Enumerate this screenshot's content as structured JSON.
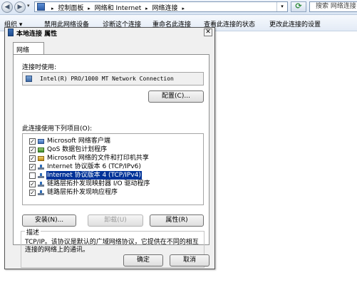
{
  "explorer": {
    "address": {
      "crumbs": [
        "控制面板",
        "网络和 Internet",
        "网络连接"
      ]
    },
    "search_placeholder": "搜索 网络连接",
    "toolbar": [
      "组织 ▾",
      "禁用此网络设备",
      "诊断这个连接",
      "重命名此连接",
      "查看此连接的状态",
      "更改此连接的设置"
    ],
    "icons": {
      "back": "back-arrow-icon",
      "forward": "forward-arrow-icon",
      "refresh": "refresh-icon"
    }
  },
  "dialog": {
    "title": "本地连接 属性",
    "close_glyph": "✕",
    "tab": "网络",
    "connect_using_label": "连接时使用:",
    "adapter_name": "Intel(R) PRO/1000 MT Network Connection",
    "configure_button": "配置(C)...",
    "items_label": "此连接使用下列项目(O):",
    "items": [
      {
        "label": "Microsoft 网络客户端",
        "checked": true,
        "icon": "client-icon",
        "selected": false
      },
      {
        "label": "QoS 数据包计划程序",
        "checked": true,
        "icon": "qos-icon",
        "selected": false
      },
      {
        "label": "Microsoft 网络的文件和打印机共享",
        "checked": true,
        "icon": "share-icon",
        "selected": false
      },
      {
        "label": "Internet 协议版本 6 (TCP/IPv6)",
        "checked": true,
        "icon": "protocol-icon",
        "selected": false
      },
      {
        "label": "Internet 协议版本 4 (TCP/IPv4)",
        "checked": false,
        "icon": "protocol-icon",
        "selected": true
      },
      {
        "label": "链路层拓扑发现映射器 I/O 驱动程序",
        "checked": true,
        "icon": "protocol-icon",
        "selected": false
      },
      {
        "label": "链路层拓扑发现响应程序",
        "checked": true,
        "icon": "protocol-icon",
        "selected": false
      }
    ],
    "install_button": "安装(N)...",
    "uninstall_button": "卸载(U)",
    "properties_button": "属性(R)",
    "description_legend": "描述",
    "description_text": "TCP/IP。该协议是默认的广域网络协议，它提供在不同的相互连接的网络上的通讯。",
    "ok_button": "确定",
    "cancel_button": "取消"
  },
  "colors": {
    "selection": "#003399",
    "dialog_bg": "#f0f0f0"
  }
}
